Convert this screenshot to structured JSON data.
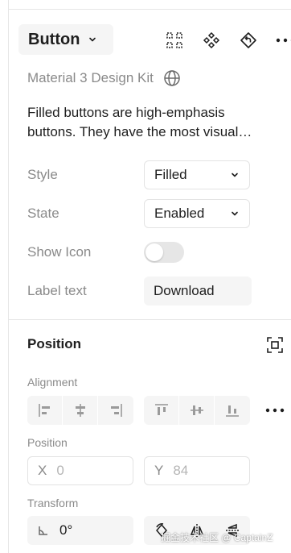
{
  "header": {
    "component_name": "Button",
    "icons": [
      "component-grid-icon",
      "instance-icon",
      "detach-icon",
      "more-icon"
    ]
  },
  "library": {
    "name": "Material 3 Design Kit"
  },
  "description": "Filled buttons are high-emphasis buttons. They have the most visual…",
  "properties": {
    "style": {
      "label": "Style",
      "value": "Filled"
    },
    "state": {
      "label": "State",
      "value": "Enabled"
    },
    "show_icon": {
      "label": "Show Icon",
      "on": false
    },
    "label_text": {
      "label": "Label text",
      "value": "Download"
    }
  },
  "position": {
    "title": "Position",
    "alignment_label": "Alignment",
    "position_label": "Position",
    "x_axis": "X",
    "x_value": "0",
    "y_axis": "Y",
    "y_value": "84",
    "transform_label": "Transform",
    "rotation_value": "0°"
  },
  "watermark": "掘金技术社区 @ CaptainZ"
}
